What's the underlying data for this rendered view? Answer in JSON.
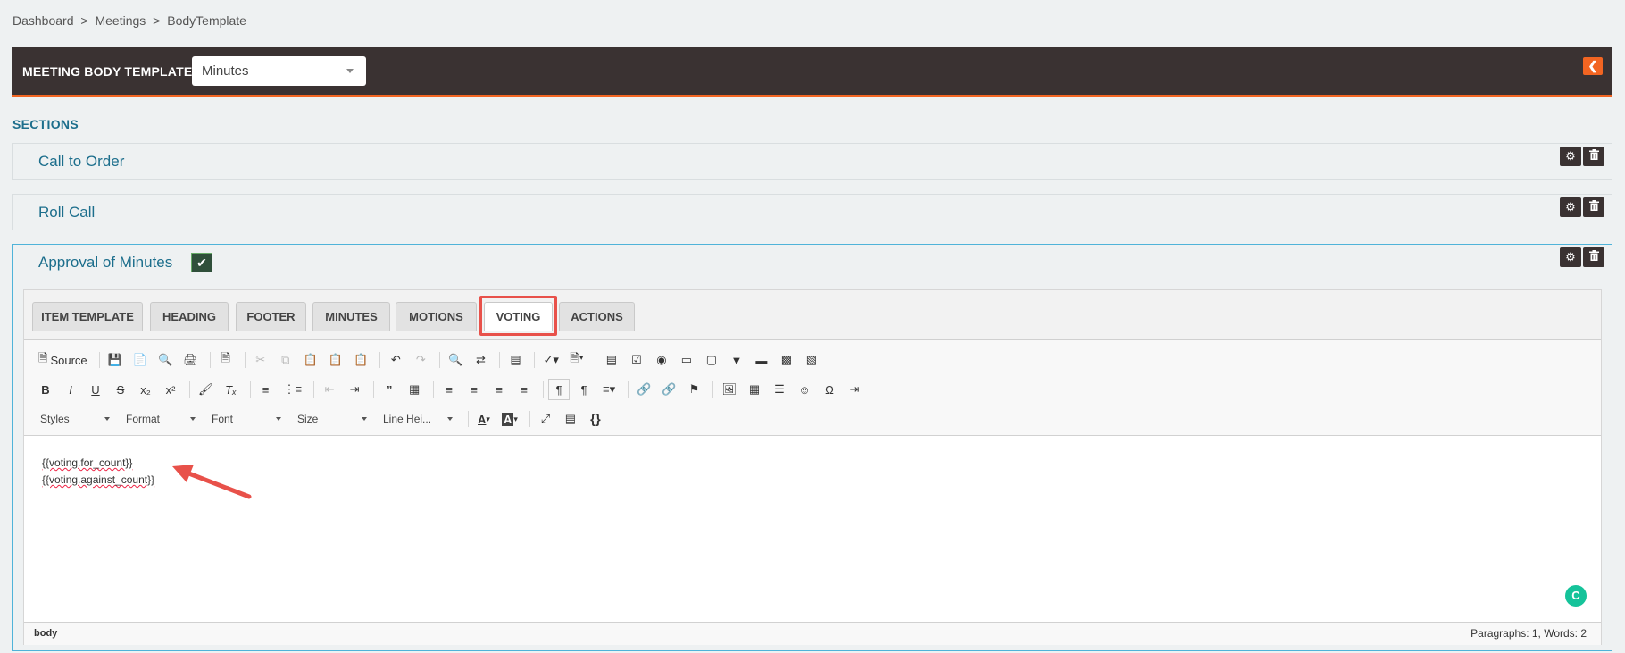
{
  "breadcrumb": {
    "dashboard": "Dashboard",
    "meetings": "Meetings",
    "current": "BodyTemplate",
    "sep": ">"
  },
  "header": {
    "title": "MEETING BODY TEMPLATE",
    "select_value": "Minutes",
    "accent": "#f26522"
  },
  "sections": {
    "label": "SECTIONS",
    "items": [
      {
        "title": "Call to Order"
      },
      {
        "title": "Roll Call"
      },
      {
        "title": "Approval of Minutes",
        "checked": true
      }
    ]
  },
  "tabs": [
    {
      "label": "ITEM TEMPLATE"
    },
    {
      "label": "HEADING"
    },
    {
      "label": "FOOTER"
    },
    {
      "label": "MINUTES"
    },
    {
      "label": "MOTIONS"
    },
    {
      "label": "VOTING",
      "active": true
    },
    {
      "label": "ACTIONS"
    }
  ],
  "toolbar": {
    "source_label": "Source",
    "styles": "Styles",
    "format": "Format",
    "font": "Font",
    "size": "Size",
    "line_height": "Line Hei..."
  },
  "editor": {
    "lines": [
      "{{voting.for_count}}",
      "{{voting.against_count}}"
    ],
    "status_path": "body",
    "status_count": "Paragraphs: 1, Words: 2"
  }
}
